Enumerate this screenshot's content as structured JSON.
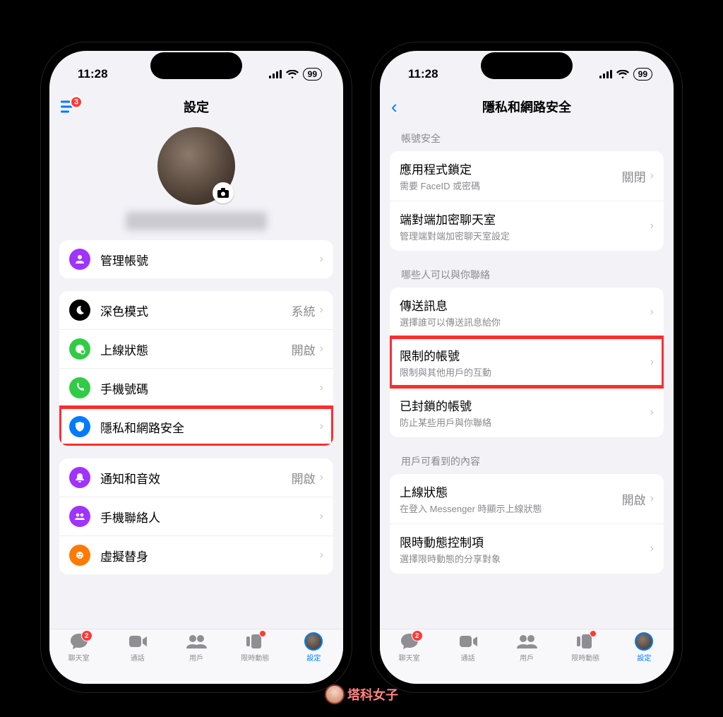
{
  "status": {
    "time": "11:28",
    "battery": "99"
  },
  "phone1": {
    "header_title": "設定",
    "menu_badge": "3",
    "rows": {
      "manage_account": "管理帳號",
      "dark_mode": {
        "label": "深色模式",
        "value": "系統"
      },
      "active_status": {
        "label": "上線狀態",
        "value": "開啟"
      },
      "phone_number": "手機號碼",
      "privacy": "隱私和網路安全",
      "notifications": {
        "label": "通知和音效",
        "value": "開啟"
      },
      "phone_contacts": "手機聯絡人",
      "avatars": "虛擬替身"
    }
  },
  "phone2": {
    "header_title": "隱私和網路安全",
    "sections": {
      "account_security": "帳號安全",
      "who_can_contact": "哪些人可以與你聯絡",
      "what_users_see": "用戶可看到的內容"
    },
    "rows": {
      "app_lock": {
        "label": "應用程式鎖定",
        "sub": "需要 FaceID 或密碼",
        "value": "關閉"
      },
      "e2ee": {
        "label": "端對端加密聊天室",
        "sub": "管理端對端加密聊天室設定"
      },
      "message_delivery": {
        "label": "傳送訊息",
        "sub": "選擇誰可以傳送訊息給你"
      },
      "restricted": {
        "label": "限制的帳號",
        "sub": "限制與其他用戶的互動"
      },
      "blocked": {
        "label": "已封鎖的帳號",
        "sub": "防止某些用戶與你聯絡"
      },
      "active_status": {
        "label": "上線狀態",
        "sub": "在登入 Messenger 時顯示上線狀態",
        "value": "開啟"
      },
      "stories": {
        "label": "限時動態控制項",
        "sub": "選擇限時動態的分享對象"
      }
    }
  },
  "tabs": {
    "chats": "聊天室",
    "calls": "通話",
    "people": "用戶",
    "stories": "限時動態",
    "settings": "設定",
    "chat_badge": "2"
  },
  "watermark": "塔科女子"
}
